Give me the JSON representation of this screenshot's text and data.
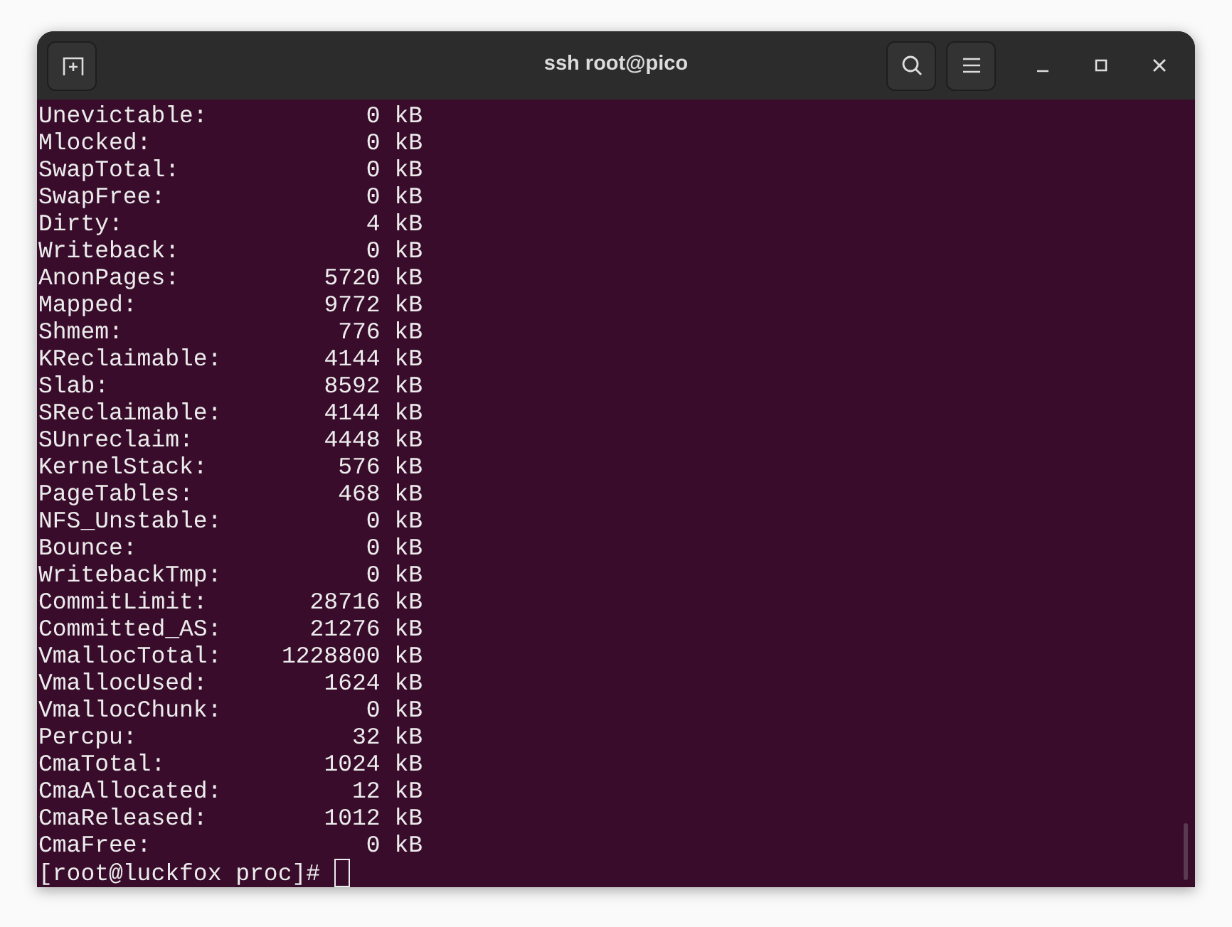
{
  "window": {
    "title": "ssh root@pico"
  },
  "lines": [
    {
      "name": "Unevictable:",
      "value": "0 kB"
    },
    {
      "name": "Mlocked:",
      "value": "0 kB"
    },
    {
      "name": "SwapTotal:",
      "value": "0 kB"
    },
    {
      "name": "SwapFree:",
      "value": "0 kB"
    },
    {
      "name": "Dirty:",
      "value": "4 kB"
    },
    {
      "name": "Writeback:",
      "value": "0 kB"
    },
    {
      "name": "AnonPages:",
      "value": "5720 kB"
    },
    {
      "name": "Mapped:",
      "value": "9772 kB"
    },
    {
      "name": "Shmem:",
      "value": "776 kB"
    },
    {
      "name": "KReclaimable:",
      "value": "4144 kB"
    },
    {
      "name": "Slab:",
      "value": "8592 kB"
    },
    {
      "name": "SReclaimable:",
      "value": "4144 kB"
    },
    {
      "name": "SUnreclaim:",
      "value": "4448 kB"
    },
    {
      "name": "KernelStack:",
      "value": "576 kB"
    },
    {
      "name": "PageTables:",
      "value": "468 kB"
    },
    {
      "name": "NFS_Unstable:",
      "value": "0 kB"
    },
    {
      "name": "Bounce:",
      "value": "0 kB"
    },
    {
      "name": "WritebackTmp:",
      "value": "0 kB"
    },
    {
      "name": "CommitLimit:",
      "value": "28716 kB"
    },
    {
      "name": "Committed_AS:",
      "value": "21276 kB"
    },
    {
      "name": "VmallocTotal:",
      "value": "1228800 kB"
    },
    {
      "name": "VmallocUsed:",
      "value": "1624 kB"
    },
    {
      "name": "VmallocChunk:",
      "value": "0 kB"
    },
    {
      "name": "Percpu:",
      "value": "32 kB"
    },
    {
      "name": "CmaTotal:",
      "value": "1024 kB"
    },
    {
      "name": "CmaAllocated:",
      "value": "12 kB"
    },
    {
      "name": "CmaReleased:",
      "value": "1012 kB"
    },
    {
      "name": "CmaFree:",
      "value": "0 kB"
    }
  ],
  "prompt": "[root@luckfox proc]#"
}
